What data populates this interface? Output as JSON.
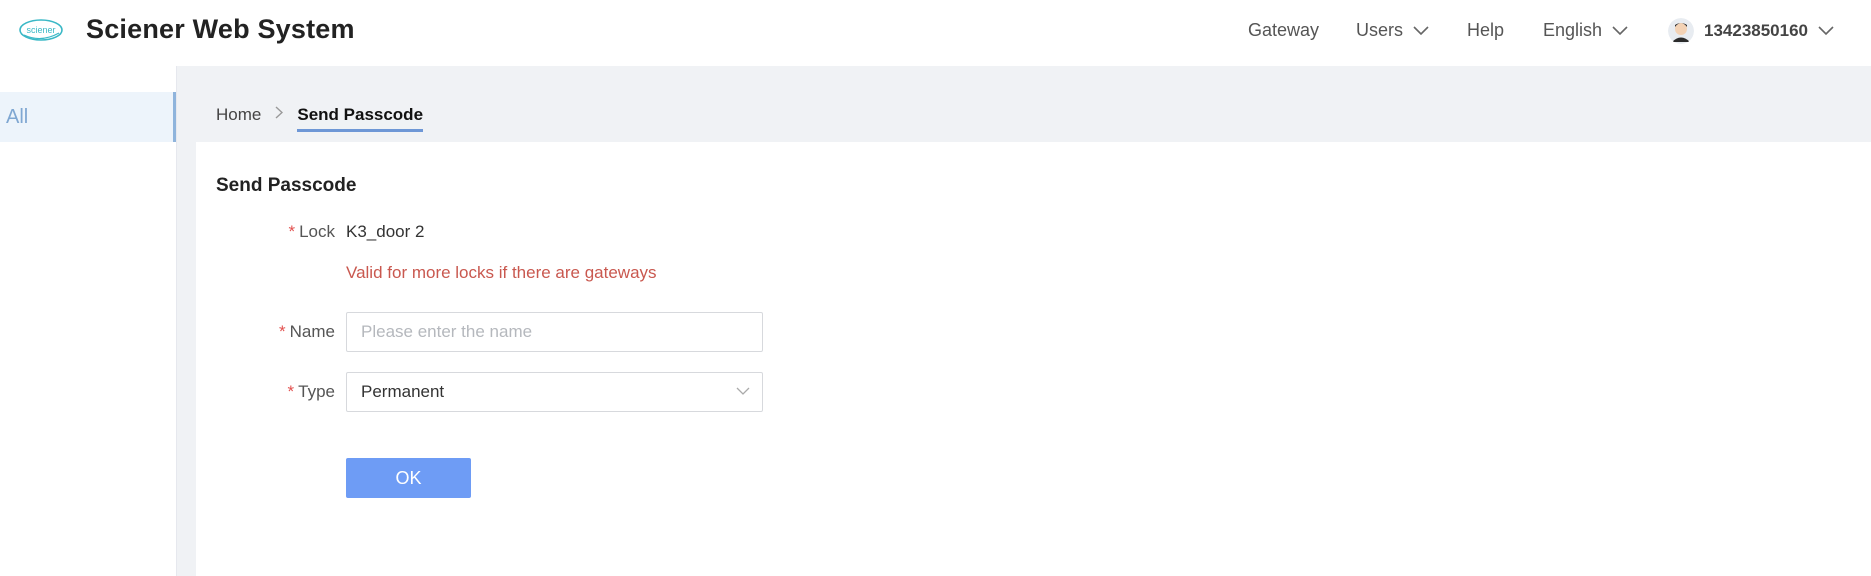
{
  "header": {
    "logo_text": "sciener",
    "title": "Sciener Web System",
    "nav": {
      "gateway": "Gateway",
      "users": "Users",
      "help": "Help",
      "language": "English",
      "account": "13423850160"
    }
  },
  "sidebar": {
    "items": [
      {
        "label": "All",
        "active": true
      }
    ]
  },
  "breadcrumb": {
    "home": "Home",
    "current": "Send Passcode"
  },
  "form": {
    "title": "Send Passcode",
    "lock": {
      "label": "Lock",
      "value": "K3_door 2",
      "hint": "Valid for more locks if there are gateways"
    },
    "name": {
      "label": "Name",
      "value": "",
      "placeholder": "Please enter the name"
    },
    "type": {
      "label": "Type",
      "value": "Permanent"
    },
    "required_mark": "*",
    "ok_label": "OK"
  },
  "colors": {
    "accent": "#6e9cf5",
    "sidebar_active": "#7fa7d2",
    "hint": "#c9584f",
    "required": "#e2504e",
    "logo": "#3ab8c6"
  }
}
